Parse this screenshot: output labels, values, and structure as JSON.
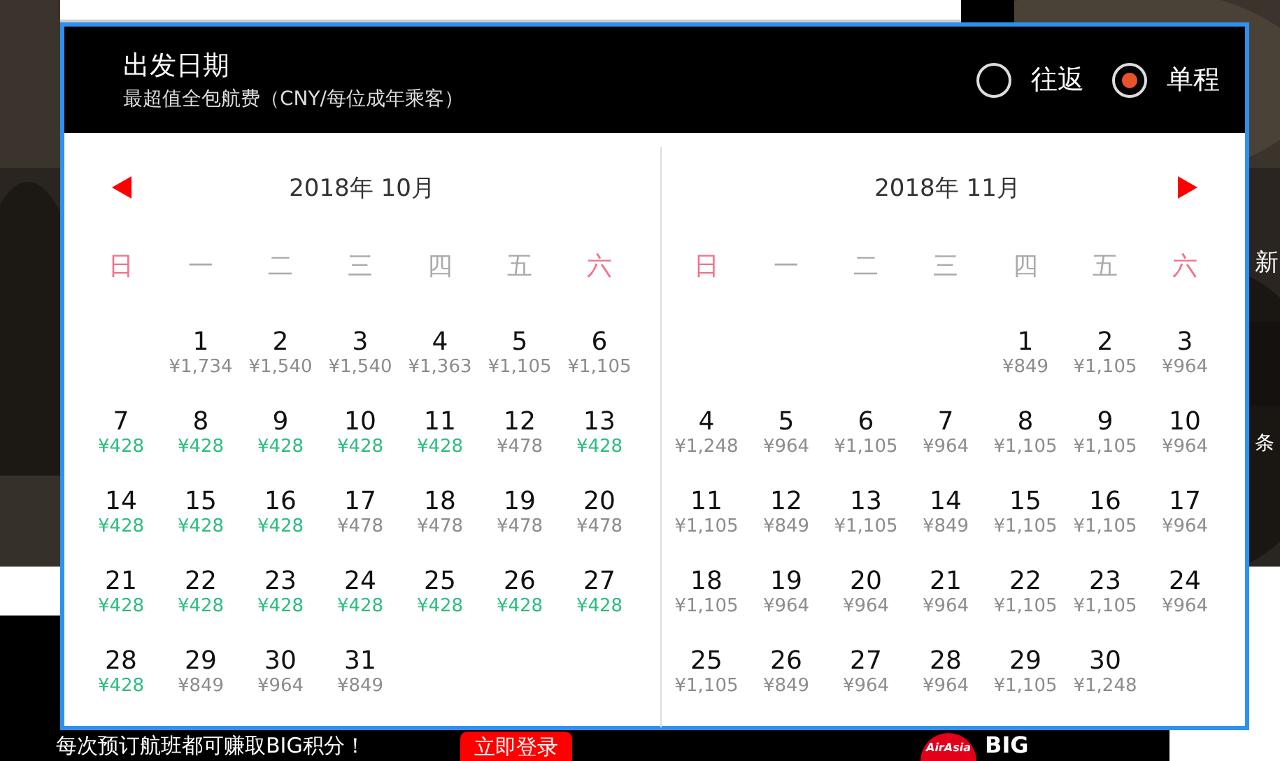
{
  "background": {
    "side_texts": [
      "新",
      "条"
    ],
    "promo": {
      "text": "每次预订航班都可赚取BIG积分！",
      "button": "立即登录",
      "brand": "AirAsia",
      "loyalty": [
        "BIG"
      ]
    }
  },
  "dialog": {
    "title": "出发日期",
    "subtitle": "最超值全包航费（CNY/每位成年乘客）",
    "trip_types": [
      {
        "label": "往返",
        "selected": false
      },
      {
        "label": "单程",
        "selected": true
      }
    ],
    "months": [
      {
        "title": "2018年 10月",
        "weekdays": [
          {
            "label": "日",
            "weekend": true
          },
          {
            "label": "一",
            "weekend": false
          },
          {
            "label": "二",
            "weekend": false
          },
          {
            "label": "三",
            "weekend": false
          },
          {
            "label": "四",
            "weekend": false
          },
          {
            "label": "五",
            "weekend": false
          },
          {
            "label": "六",
            "weekend": true
          }
        ],
        "weeks": [
          [
            {
              "kind": "empty"
            },
            {
              "kind": "date",
              "day": "1",
              "price": "¥1,734",
              "color": "#8c8c8c"
            },
            {
              "kind": "date",
              "day": "2",
              "price": "¥1,540",
              "color": "#8c8c8c"
            },
            {
              "kind": "date",
              "day": "3",
              "price": "¥1,540",
              "color": "#8c8c8c"
            },
            {
              "kind": "date",
              "day": "4",
              "price": "¥1,363",
              "color": "#8c8c8c"
            },
            {
              "kind": "date",
              "day": "5",
              "price": "¥1,105",
              "color": "#8c8c8c"
            },
            {
              "kind": "date",
              "day": "6",
              "price": "¥1,105",
              "color": "#8c8c8c"
            }
          ],
          [
            {
              "kind": "date",
              "day": "7",
              "price": "¥428",
              "color": "#2dbd7e"
            },
            {
              "kind": "date",
              "day": "8",
              "price": "¥428",
              "color": "#2dbd7e"
            },
            {
              "kind": "date",
              "day": "9",
              "price": "¥428",
              "color": "#2dbd7e"
            },
            {
              "kind": "date",
              "day": "10",
              "price": "¥428",
              "color": "#2dbd7e"
            },
            {
              "kind": "date",
              "day": "11",
              "price": "¥428",
              "color": "#2dbd7e"
            },
            {
              "kind": "date",
              "day": "12",
              "price": "¥478",
              "color": "#8c8c8c"
            },
            {
              "kind": "date",
              "day": "13",
              "price": "¥428",
              "color": "#2dbd7e"
            }
          ],
          [
            {
              "kind": "date",
              "day": "14",
              "price": "¥428",
              "color": "#2dbd7e"
            },
            {
              "kind": "date",
              "day": "15",
              "price": "¥428",
              "color": "#2dbd7e"
            },
            {
              "kind": "date",
              "day": "16",
              "price": "¥428",
              "color": "#2dbd7e"
            },
            {
              "kind": "date",
              "day": "17",
              "price": "¥478",
              "color": "#8c8c8c"
            },
            {
              "kind": "date",
              "day": "18",
              "price": "¥478",
              "color": "#8c8c8c"
            },
            {
              "kind": "date",
              "day": "19",
              "price": "¥478",
              "color": "#8c8c8c"
            },
            {
              "kind": "date",
              "day": "20",
              "price": "¥478",
              "color": "#8c8c8c"
            }
          ],
          [
            {
              "kind": "date",
              "day": "21",
              "price": "¥428",
              "color": "#2dbd7e"
            },
            {
              "kind": "date",
              "day": "22",
              "price": "¥428",
              "color": "#2dbd7e"
            },
            {
              "kind": "date",
              "day": "23",
              "price": "¥428",
              "color": "#2dbd7e"
            },
            {
              "kind": "date",
              "day": "24",
              "price": "¥428",
              "color": "#2dbd7e"
            },
            {
              "kind": "date",
              "day": "25",
              "price": "¥428",
              "color": "#2dbd7e"
            },
            {
              "kind": "date",
              "day": "26",
              "price": "¥428",
              "color": "#2dbd7e"
            },
            {
              "kind": "date",
              "day": "27",
              "price": "¥428",
              "color": "#2dbd7e"
            }
          ],
          [
            {
              "kind": "date",
              "day": "28",
              "price": "¥428",
              "color": "#2dbd7e"
            },
            {
              "kind": "date",
              "day": "29",
              "price": "¥849",
              "color": "#8c8c8c"
            },
            {
              "kind": "date",
              "day": "30",
              "price": "¥964",
              "color": "#8c8c8c"
            },
            {
              "kind": "date",
              "day": "31",
              "price": "¥849",
              "color": "#8c8c8c"
            }
          ]
        ]
      },
      {
        "title": "2018年 11月",
        "weekdays": [
          {
            "label": "日",
            "weekend": true
          },
          {
            "label": "一",
            "weekend": false
          },
          {
            "label": "二",
            "weekend": false
          },
          {
            "label": "三",
            "weekend": false
          },
          {
            "label": "四",
            "weekend": false
          },
          {
            "label": "五",
            "weekend": false
          },
          {
            "label": "六",
            "weekend": true
          }
        ],
        "weeks": [
          [
            {
              "kind": "empty"
            },
            {
              "kind": "empty"
            },
            {
              "kind": "empty"
            },
            {
              "kind": "empty"
            },
            {
              "kind": "date",
              "day": "1",
              "price": "¥849",
              "color": "#8c8c8c"
            },
            {
              "kind": "date",
              "day": "2",
              "price": "¥1,105",
              "color": "#8c8c8c"
            },
            {
              "kind": "date",
              "day": "3",
              "price": "¥964",
              "color": "#8c8c8c"
            }
          ],
          [
            {
              "kind": "date",
              "day": "4",
              "price": "¥1,248",
              "color": "#8c8c8c"
            },
            {
              "kind": "date",
              "day": "5",
              "price": "¥964",
              "color": "#8c8c8c"
            },
            {
              "kind": "date",
              "day": "6",
              "price": "¥1,105",
              "color": "#8c8c8c"
            },
            {
              "kind": "date",
              "day": "7",
              "price": "¥964",
              "color": "#8c8c8c"
            },
            {
              "kind": "date",
              "day": "8",
              "price": "¥1,105",
              "color": "#8c8c8c"
            },
            {
              "kind": "date",
              "day": "9",
              "price": "¥1,105",
              "color": "#8c8c8c"
            },
            {
              "kind": "date",
              "day": "10",
              "price": "¥964",
              "color": "#8c8c8c"
            }
          ],
          [
            {
              "kind": "date",
              "day": "11",
              "price": "¥1,105",
              "color": "#8c8c8c"
            },
            {
              "kind": "date",
              "day": "12",
              "price": "¥849",
              "color": "#8c8c8c"
            },
            {
              "kind": "date",
              "day": "13",
              "price": "¥1,105",
              "color": "#8c8c8c"
            },
            {
              "kind": "date",
              "day": "14",
              "price": "¥849",
              "color": "#8c8c8c"
            },
            {
              "kind": "date",
              "day": "15",
              "price": "¥1,105",
              "color": "#8c8c8c"
            },
            {
              "kind": "date",
              "day": "16",
              "price": "¥1,105",
              "color": "#8c8c8c"
            },
            {
              "kind": "date",
              "day": "17",
              "price": "¥964",
              "color": "#8c8c8c"
            }
          ],
          [
            {
              "kind": "date",
              "day": "18",
              "price": "¥1,105",
              "color": "#8c8c8c"
            },
            {
              "kind": "date",
              "day": "19",
              "price": "¥964",
              "color": "#8c8c8c"
            },
            {
              "kind": "date",
              "day": "20",
              "price": "¥964",
              "color": "#8c8c8c"
            },
            {
              "kind": "date",
              "day": "21",
              "price": "¥964",
              "color": "#8c8c8c"
            },
            {
              "kind": "date",
              "day": "22",
              "price": "¥1,105",
              "color": "#8c8c8c"
            },
            {
              "kind": "date",
              "day": "23",
              "price": "¥1,105",
              "color": "#8c8c8c"
            },
            {
              "kind": "date",
              "day": "24",
              "price": "¥964",
              "color": "#8c8c8c"
            }
          ],
          [
            {
              "kind": "date",
              "day": "25",
              "price": "¥1,105",
              "color": "#8c8c8c"
            },
            {
              "kind": "date",
              "day": "26",
              "price": "¥849",
              "color": "#8c8c8c"
            },
            {
              "kind": "date",
              "day": "27",
              "price": "¥964",
              "color": "#8c8c8c"
            },
            {
              "kind": "date",
              "day": "28",
              "price": "¥964",
              "color": "#8c8c8c"
            },
            {
              "kind": "date",
              "day": "29",
              "price": "¥1,105",
              "color": "#8c8c8c"
            },
            {
              "kind": "date",
              "day": "30",
              "price": "¥1,248",
              "color": "#8c8c8c"
            }
          ]
        ]
      }
    ]
  }
}
